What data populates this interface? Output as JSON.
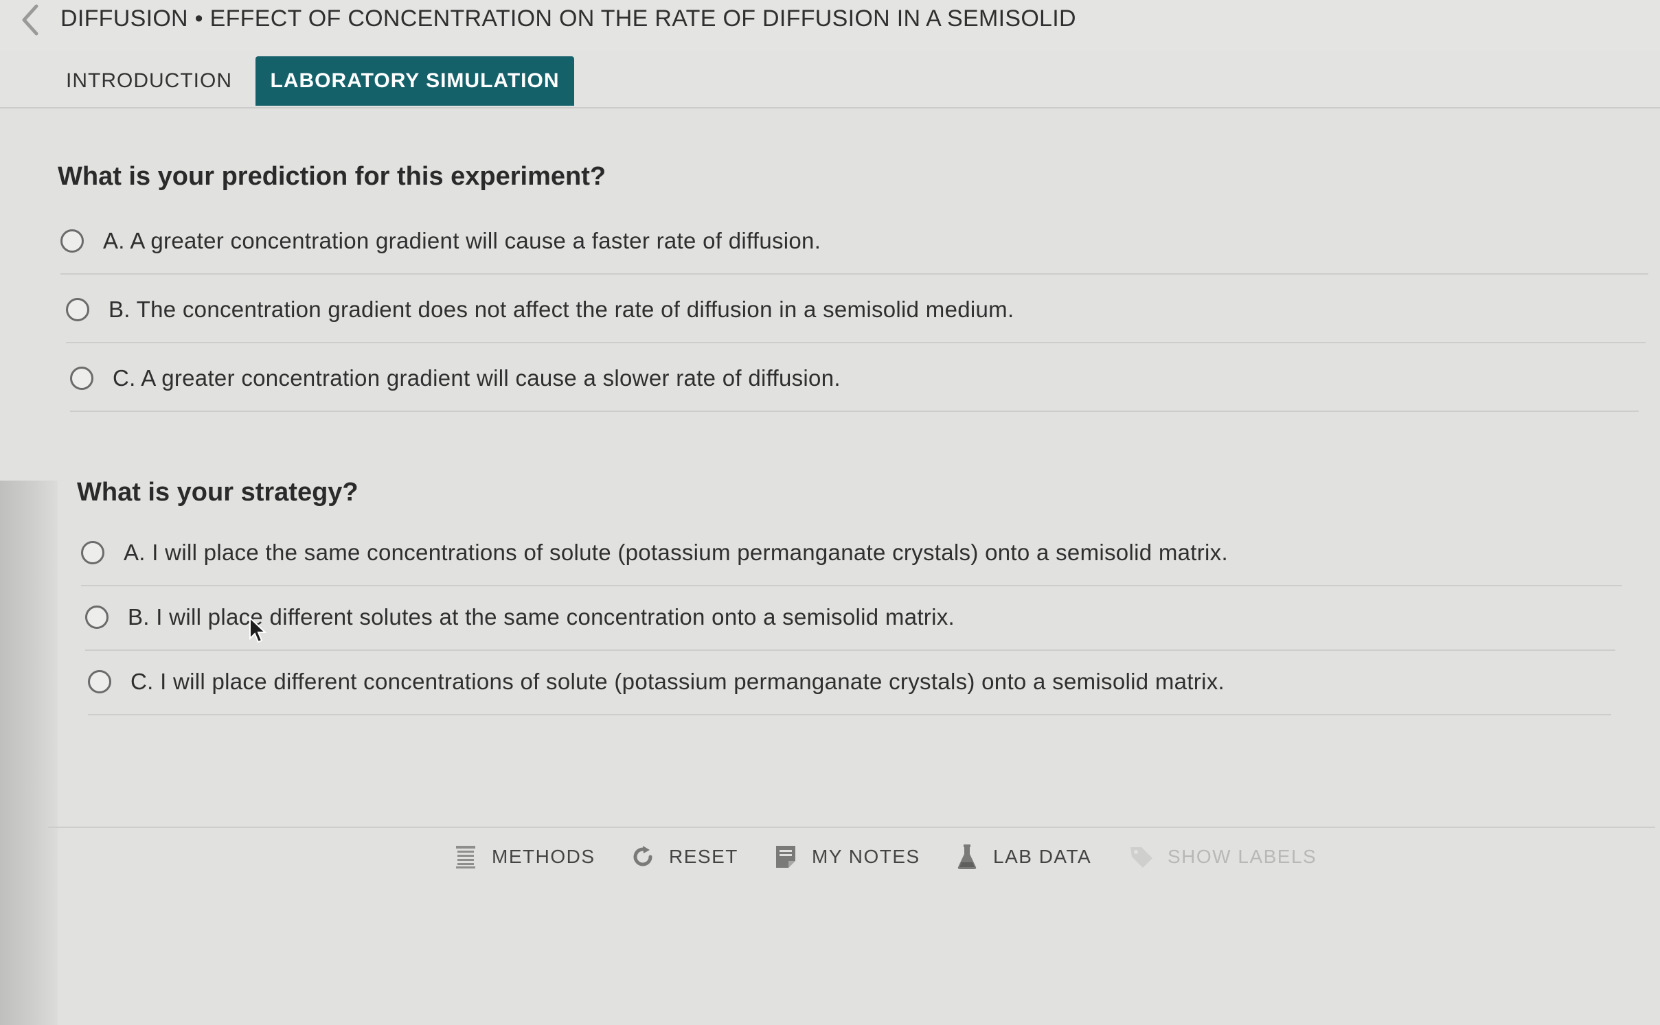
{
  "header": {
    "back_icon": "chevron-left-icon",
    "title": "DIFFUSION • EFFECT OF CONCENTRATION ON THE RATE OF DIFFUSION IN A SEMISOLID"
  },
  "tabs": {
    "introduction": "INTRODUCTION",
    "lab_simulation": "LABORATORY SIMULATION",
    "active": "LABORATORY SIMULATION"
  },
  "prediction": {
    "question": "What is your prediction for this experiment?",
    "options": [
      "A. A greater concentration gradient will cause a faster rate of diffusion.",
      "B. The concentration gradient does not affect the rate of diffusion in a semisolid medium.",
      "C. A greater concentration gradient will cause a slower rate of diffusion."
    ]
  },
  "strategy": {
    "question": "What is your strategy?",
    "options": [
      "A. I will place the same concentrations of solute (potassium permanganate crystals) onto a semisolid matrix.",
      "B. I will place different solutes at the same concentration onto a semisolid matrix.",
      "C. I will place different concentrations of solute (potassium permanganate crystals) onto a semisolid matrix."
    ]
  },
  "toolbar": {
    "methods": "METHODS",
    "reset": "RESET",
    "my_notes": "MY NOTES",
    "lab_data": "LAB DATA",
    "show_labels": "SHOW LABELS"
  },
  "colors": {
    "accent": "#15616a",
    "background": "#e1e1df",
    "disabled_text": "#b8b8b6"
  }
}
